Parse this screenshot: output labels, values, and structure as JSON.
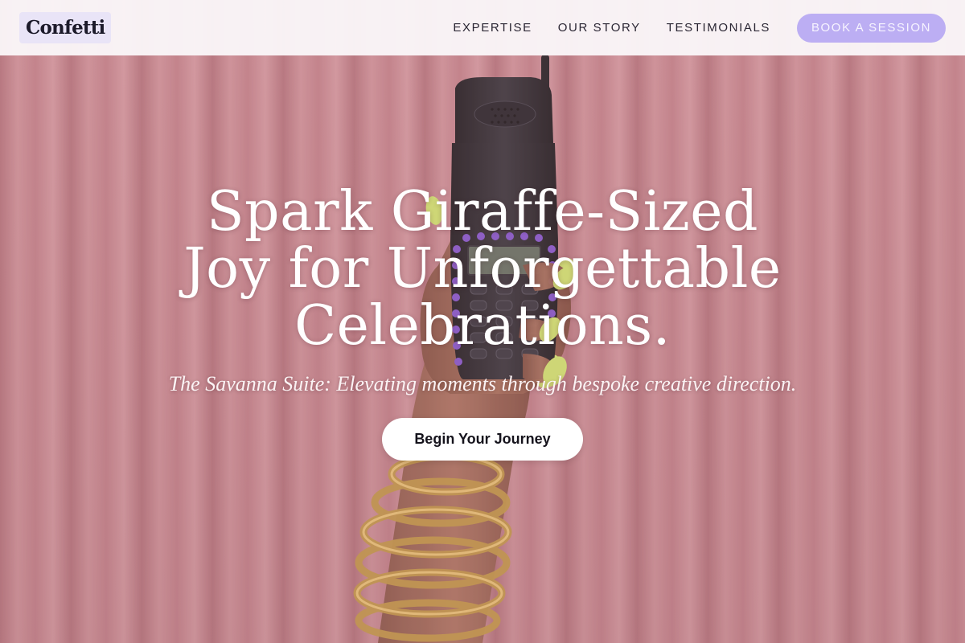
{
  "header": {
    "logo": "Confetti",
    "nav": [
      {
        "label": "EXPERTISE"
      },
      {
        "label": "OUR STORY"
      },
      {
        "label": "TESTIMONIALS"
      }
    ],
    "cta_label": "BOOK A SESSION"
  },
  "hero": {
    "title": "Spark Giraffe-Sized Joy for Unforgettable Celebrations.",
    "subtitle": "The Savanna Suite: Elevating moments through bespoke creative direction.",
    "cta_label": "Begin Your Journey",
    "image_description_icon": "hand-holding-phone-image"
  },
  "colors": {
    "accent": "#bcaef3",
    "curtain": "#c98a91",
    "text_dark": "#1c1a2a"
  }
}
